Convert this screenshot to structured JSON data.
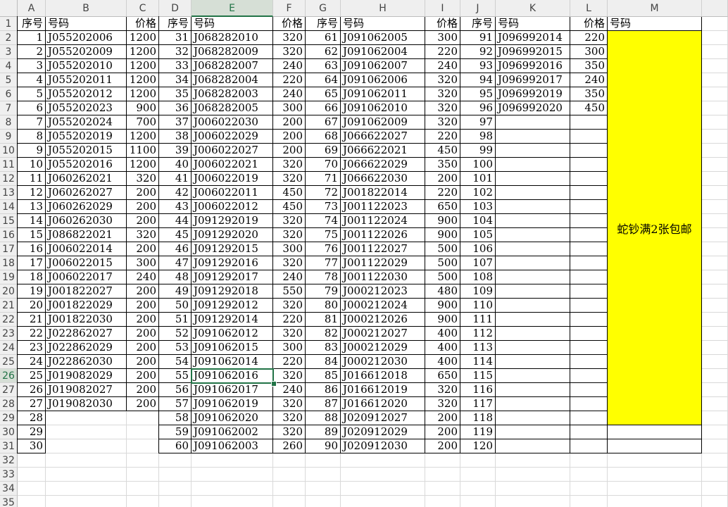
{
  "columns": [
    "A",
    "B",
    "C",
    "D",
    "E",
    "F",
    "G",
    "H",
    "I",
    "J",
    "K",
    "L",
    "M"
  ],
  "selected_cell": "E26",
  "merged_note": "蛇钞满2张包邮",
  "header_row": [
    "序号",
    "号码",
    "价格",
    "序号",
    "号码",
    "价格",
    "序号",
    "号码",
    "价格",
    "序号",
    "号码",
    "价格",
    "号码"
  ],
  "rows": [
    [
      "1",
      "J055202006",
      "1200",
      "31",
      "J068282010",
      "320",
      "61",
      "J091062005",
      "300",
      "91",
      "J096992014",
      "220",
      ""
    ],
    [
      "2",
      "J055202009",
      "1200",
      "32",
      "J068282009",
      "320",
      "62",
      "J091062004",
      "220",
      "92",
      "J096992015",
      "300",
      ""
    ],
    [
      "3",
      "J055202010",
      "1200",
      "33",
      "J068282007",
      "240",
      "63",
      "J091062007",
      "240",
      "93",
      "J096992016",
      "350",
      ""
    ],
    [
      "4",
      "J055202011",
      "1200",
      "34",
      "J068282004",
      "220",
      "64",
      "J091062006",
      "320",
      "94",
      "J096992017",
      "240",
      ""
    ],
    [
      "5",
      "J055202012",
      "1200",
      "35",
      "J068282003",
      "240",
      "65",
      "J091062011",
      "320",
      "95",
      "J096992019",
      "350",
      ""
    ],
    [
      "6",
      "J055202023",
      "900",
      "36",
      "J068282005",
      "300",
      "66",
      "J091062010",
      "320",
      "96",
      "J096992020",
      "450",
      ""
    ],
    [
      "7",
      "J055202024",
      "700",
      "37",
      "J006022030",
      "200",
      "67",
      "J091062009",
      "320",
      "97",
      "",
      "",
      ""
    ],
    [
      "8",
      "J055202019",
      "1200",
      "38",
      "J006022029",
      "200",
      "68",
      "J066622027",
      "220",
      "98",
      "",
      "",
      ""
    ],
    [
      "9",
      "J055202015",
      "1100",
      "39",
      "J006022027",
      "200",
      "69",
      "J066622021",
      "450",
      "99",
      "",
      "",
      ""
    ],
    [
      "10",
      "J055202016",
      "1200",
      "40",
      "J006022021",
      "320",
      "70",
      "J066622029",
      "350",
      "100",
      "",
      "",
      ""
    ],
    [
      "11",
      "J060262021",
      "320",
      "41",
      "J006022019",
      "320",
      "71",
      "J066622030",
      "200",
      "101",
      "",
      "",
      ""
    ],
    [
      "12",
      "J060262027",
      "200",
      "42",
      "J006022011",
      "450",
      "72",
      "J001822014",
      "220",
      "102",
      "",
      "",
      ""
    ],
    [
      "13",
      "J060262029",
      "200",
      "43",
      "J006022012",
      "450",
      "73",
      "J001122023",
      "650",
      "103",
      "",
      "",
      ""
    ],
    [
      "14",
      "J060262030",
      "200",
      "44",
      "J091292019",
      "320",
      "74",
      "J001122024",
      "900",
      "104",
      "",
      "",
      ""
    ],
    [
      "15",
      "J086822021",
      "320",
      "45",
      "J091292020",
      "320",
      "75",
      "J001122026",
      "900",
      "105",
      "",
      "",
      ""
    ],
    [
      "16",
      "J006022014",
      "200",
      "46",
      "J091292015",
      "300",
      "76",
      "J001122027",
      "500",
      "106",
      "",
      "",
      ""
    ],
    [
      "17",
      "J006022015",
      "300",
      "47",
      "J091292016",
      "320",
      "77",
      "J001122029",
      "500",
      "107",
      "",
      "",
      ""
    ],
    [
      "18",
      "J006022017",
      "240",
      "48",
      "J091292017",
      "240",
      "78",
      "J001122030",
      "500",
      "108",
      "",
      "",
      ""
    ],
    [
      "19",
      "J001822027",
      "200",
      "49",
      "J091292018",
      "550",
      "79",
      "J000212023",
      "480",
      "109",
      "",
      "",
      ""
    ],
    [
      "20",
      "J001822029",
      "200",
      "50",
      "J091292012",
      "320",
      "80",
      "J000212024",
      "900",
      "110",
      "",
      "",
      ""
    ],
    [
      "21",
      "J001822030",
      "200",
      "51",
      "J091292014",
      "220",
      "81",
      "J000212026",
      "900",
      "111",
      "",
      "",
      ""
    ],
    [
      "22",
      "J022862027",
      "200",
      "52",
      "J091062012",
      "320",
      "82",
      "J000212027",
      "400",
      "112",
      "",
      "",
      ""
    ],
    [
      "23",
      "J022862029",
      "200",
      "53",
      "J091062015",
      "300",
      "83",
      "J000212029",
      "400",
      "113",
      "",
      "",
      ""
    ],
    [
      "24",
      "J022862030",
      "200",
      "54",
      "J091062014",
      "220",
      "84",
      "J000212030",
      "400",
      "114",
      "",
      "",
      ""
    ],
    [
      "25",
      "J019082029",
      "200",
      "55",
      "J091062016",
      "320",
      "85",
      "J016612018",
      "650",
      "115",
      "",
      "",
      ""
    ],
    [
      "26",
      "J019082027",
      "200",
      "56",
      "J091062017",
      "240",
      "86",
      "J016612019",
      "320",
      "116",
      "",
      "",
      ""
    ],
    [
      "27",
      "J019082030",
      "200",
      "57",
      "J091062019",
      "320",
      "87",
      "J016612020",
      "320",
      "117",
      "",
      "",
      ""
    ],
    [
      "28",
      "",
      "",
      "58",
      "J091062020",
      "320",
      "88",
      "J020912027",
      "200",
      "118",
      "",
      "",
      ""
    ],
    [
      "29",
      "",
      "",
      "59",
      "J091062002",
      "320",
      "89",
      "J020912029",
      "200",
      "119",
      "",
      "",
      ""
    ],
    [
      "30",
      "",
      "",
      "60",
      "J091062003",
      "260",
      "90",
      "J020912030",
      "200",
      "120",
      "",
      "",
      ""
    ]
  ],
  "row_numbers": [
    "1",
    "2",
    "3",
    "4",
    "5",
    "6",
    "7",
    "8",
    "9",
    "10",
    "11",
    "12",
    "13",
    "14",
    "15",
    "16",
    "17",
    "18",
    "19",
    "20",
    "21",
    "22",
    "23",
    "24",
    "25",
    "26",
    "27",
    "28",
    "29",
    "30",
    "31",
    "32",
    "33",
    "34",
    "35"
  ],
  "colors": {
    "accent": "#217346",
    "highlight": "#ffff00",
    "header_bg": "#efefef"
  }
}
